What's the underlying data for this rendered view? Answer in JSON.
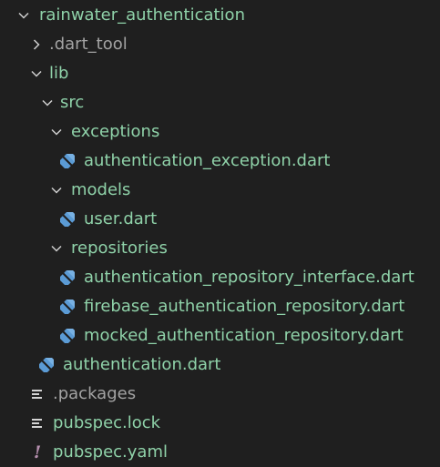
{
  "explorer": {
    "root": {
      "label": "rainwater_authentication",
      "expanded": true
    },
    "items": [
      {
        "label": ".dart_tool",
        "type": "folder",
        "expanded": false,
        "icon": "chevron-right-icon"
      },
      {
        "label": "lib",
        "type": "folder",
        "expanded": true,
        "icon": "chevron-down-icon"
      },
      {
        "label": "src",
        "type": "folder",
        "expanded": true,
        "icon": "chevron-down-icon"
      },
      {
        "label": "exceptions",
        "type": "folder",
        "expanded": true,
        "icon": "chevron-down-icon"
      },
      {
        "label": "authentication_exception.dart",
        "type": "file",
        "icon": "dart-file-icon"
      },
      {
        "label": "models",
        "type": "folder",
        "expanded": true,
        "icon": "chevron-down-icon"
      },
      {
        "label": "user.dart",
        "type": "file",
        "icon": "dart-file-icon"
      },
      {
        "label": "repositories",
        "type": "folder",
        "expanded": true,
        "icon": "chevron-down-icon"
      },
      {
        "label": "authentication_repository_interface.dart",
        "type": "file",
        "icon": "dart-file-icon"
      },
      {
        "label": "firebase_authentication_repository.dart",
        "type": "file",
        "icon": "dart-file-icon"
      },
      {
        "label": "mocked_authentication_repository.dart",
        "type": "file",
        "icon": "dart-file-icon"
      },
      {
        "label": "authentication.dart",
        "type": "file",
        "icon": "dart-file-icon"
      },
      {
        "label": ".packages",
        "type": "file",
        "icon": "lines-file-icon"
      },
      {
        "label": "pubspec.lock",
        "type": "file",
        "icon": "lines-file-icon"
      },
      {
        "label": "pubspec.yaml",
        "type": "file",
        "icon": "exclamation-icon",
        "glyph": "!"
      }
    ]
  },
  "colors": {
    "background": "#1f1f1f",
    "label_green": "#8fd2a9",
    "label_gray": "#a3a3a3",
    "dart_icon": "#5b9bd5",
    "yaml_icon": "#b48ead"
  }
}
